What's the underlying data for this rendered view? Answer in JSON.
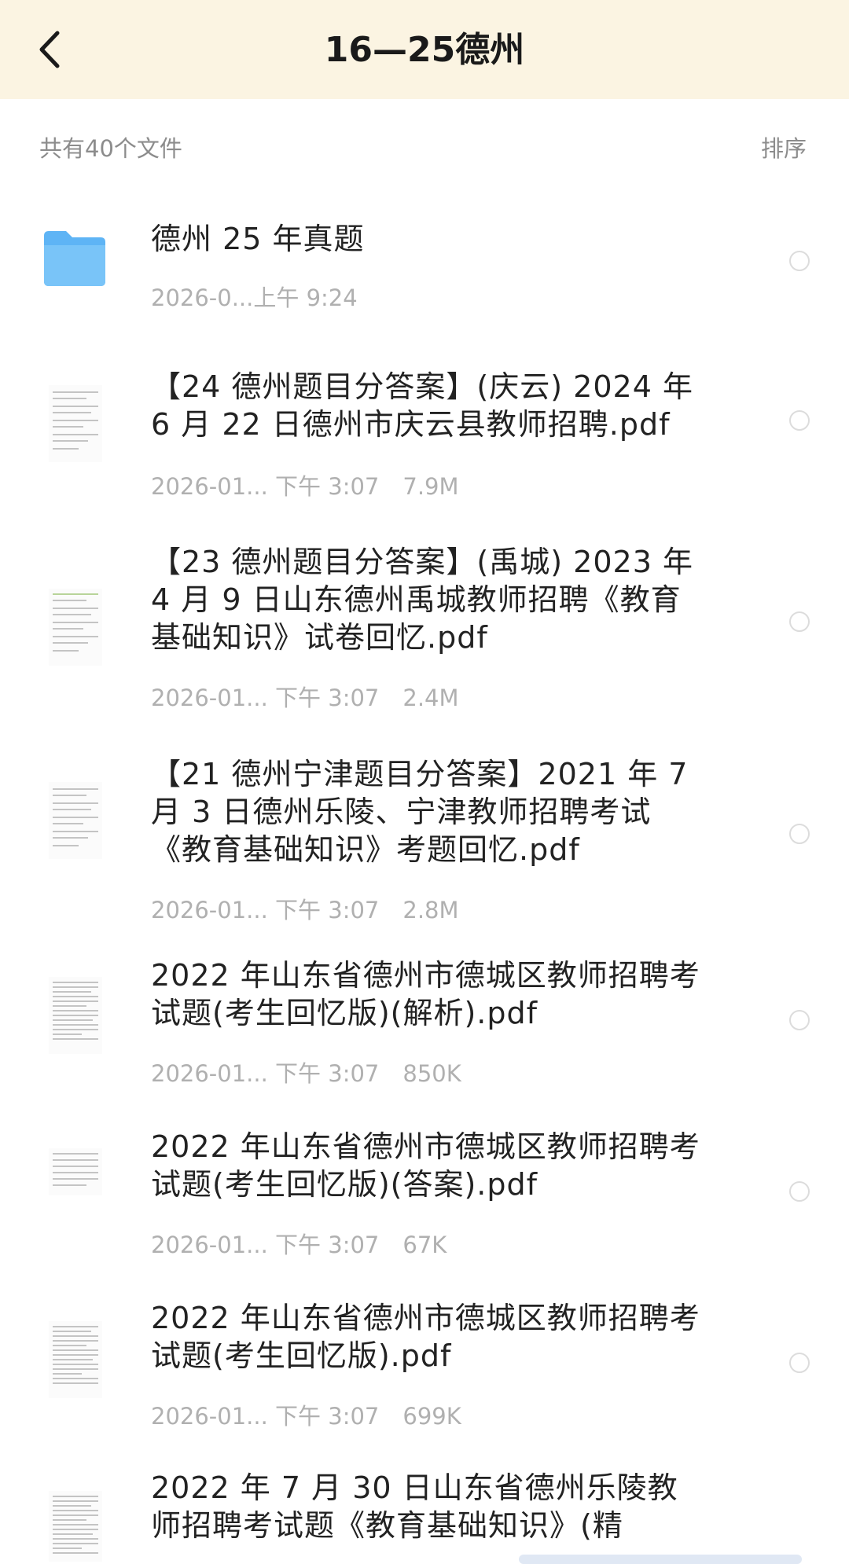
{
  "header": {
    "title": "16—25德州"
  },
  "subbar": {
    "count_text": "共有40个文件",
    "sort_label": "排序"
  },
  "items": [
    {
      "type": "folder",
      "title": "德州 25 年真题",
      "date": "2026-0...上午 9:24",
      "size": ""
    },
    {
      "type": "pdf",
      "title": "【24 德州题目分答案】(庆云) 2024 年 6 月 22 日德州市庆云县教师招聘.pdf",
      "date": "2026-01... 下午 3:07",
      "size": "7.9M"
    },
    {
      "type": "pdf",
      "title": "【23 德州题目分答案】(禹城) 2023 年 4 月 9 日山东德州禹城教师招聘《教育基础知识》试卷回忆.pdf",
      "date": "2026-01... 下午 3:07",
      "size": "2.4M"
    },
    {
      "type": "pdf",
      "title": "【21 德州宁津题目分答案】2021 年 7 月 3 日德州乐陵、宁津教师招聘考试《教育基础知识》考题回忆.pdf",
      "date": "2026-01... 下午 3:07",
      "size": "2.8M"
    },
    {
      "type": "pdf",
      "title": "2022 年山东省德州市德城区教师招聘考试题(考生回忆版)(解析).pdf",
      "date": "2026-01... 下午 3:07",
      "size": "850K"
    },
    {
      "type": "pdf",
      "title": "2022 年山东省德州市德城区教师招聘考试题(考生回忆版)(答案).pdf",
      "date": "2026-01... 下午 3:07",
      "size": "67K"
    },
    {
      "type": "pdf",
      "title": "2022 年山东省德州市德城区教师招聘考试题(考生回忆版).pdf",
      "date": "2026-01... 下午 3:07",
      "size": "699K"
    },
    {
      "type": "pdf",
      "title": "2022 年 7 月 30 日山东省德州乐陵教师招聘考试题《教育基础知识》(精",
      "date": "",
      "size": ""
    }
  ],
  "colors": {
    "header_bg": "#fbf4e2",
    "folder": "#5eb4f5",
    "meta": "#b0b0b0"
  },
  "icons": {
    "back": "chevron-left-icon",
    "folder": "folder-icon",
    "file": "pdf-thumbnail-icon"
  }
}
